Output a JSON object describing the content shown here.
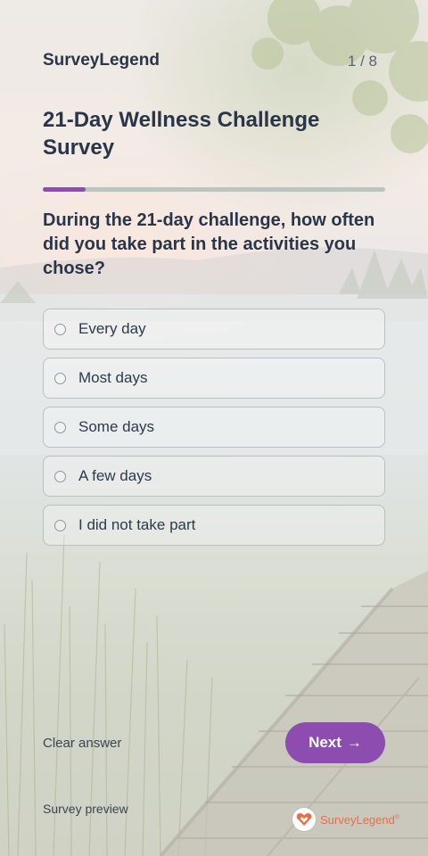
{
  "header": {
    "brand": "SurveyLegend",
    "page_counter": "1 / 8"
  },
  "survey": {
    "title": "21-Day Wellness Challenge Survey",
    "progress_fraction": 0.125
  },
  "question": {
    "text": "During the 21-day challenge, how often did you take part in the activities you chose?",
    "options": [
      "Every day",
      "Most days",
      "Some days",
      "A few days",
      "I did not take part"
    ],
    "selected": null
  },
  "footer": {
    "clear_label": "Clear answer",
    "next_label": "Next",
    "next_icon": "→",
    "preview_label": "Survey preview",
    "logo_text": "SurveyLegend",
    "logo_mark": "®"
  },
  "colors": {
    "accent": "#8c4cb0",
    "logo": "#ef6b45"
  }
}
